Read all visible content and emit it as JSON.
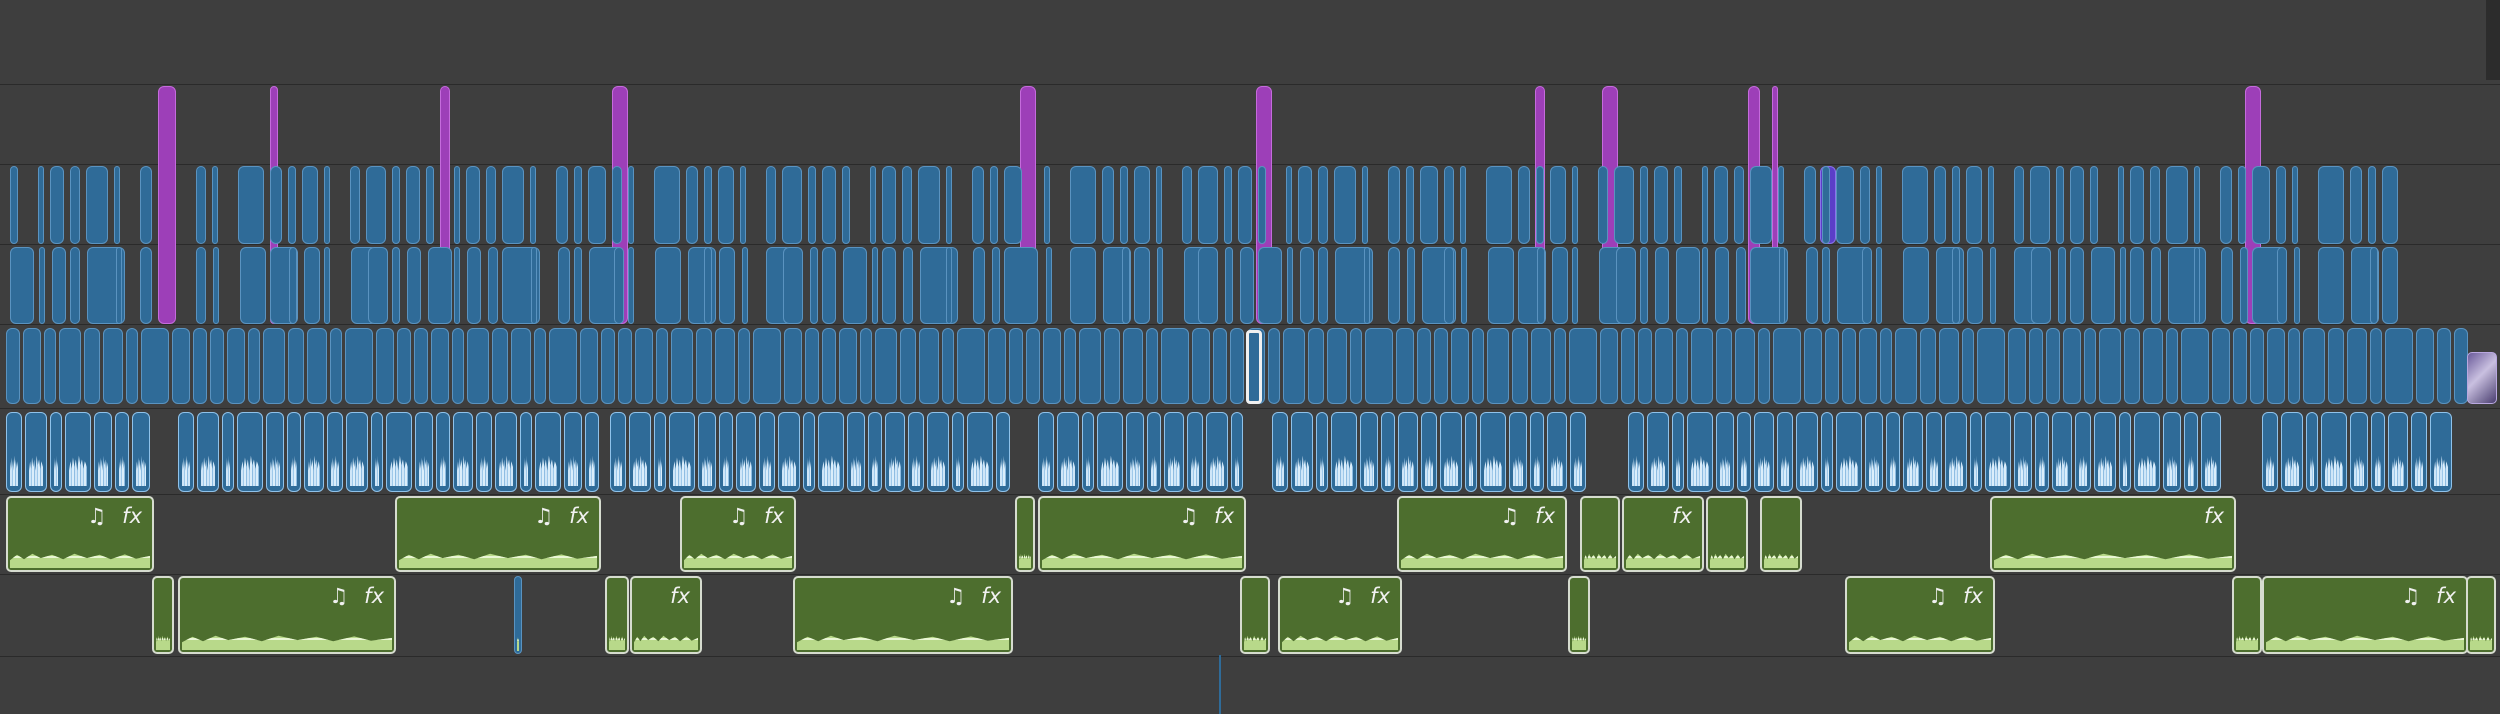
{
  "timeline": {
    "selected_clip_label": "",
    "connected_audio_icons": {
      "music_icon": "♫",
      "fx_icon": "fx"
    }
  },
  "colors": {
    "background": "#3e3e3e",
    "title_clip_purple": "#9d3fb8",
    "video_clip_blue": "#2f6b98",
    "audio_clip_green": "#4d6e2e",
    "selection_outline": "#f0f0f0"
  },
  "green_clips_row1": [
    {
      "music": "♫",
      "fx": "fx"
    },
    {
      "music": "♫",
      "fx": "fx"
    },
    {
      "music": "♫",
      "fx": "fx"
    },
    {
      "music": "♫",
      "fx": "fx"
    },
    {
      "music": "♫",
      "fx": "fx"
    },
    {
      "music": "",
      "fx": "fx"
    },
    {
      "music": "",
      "fx": "fx"
    },
    {
      "music": "♫",
      "fx": "fx"
    }
  ],
  "green_clips_row2": [
    {
      "music": "♫",
      "fx": "fx"
    },
    {
      "music": "",
      "fx": "fx"
    },
    {
      "music": "♫",
      "fx": "fx"
    },
    {
      "music": "♫",
      "fx": "fx"
    },
    {
      "music": "♫",
      "fx": "fx"
    },
    {
      "music": "♫",
      "fx": "fx"
    }
  ]
}
